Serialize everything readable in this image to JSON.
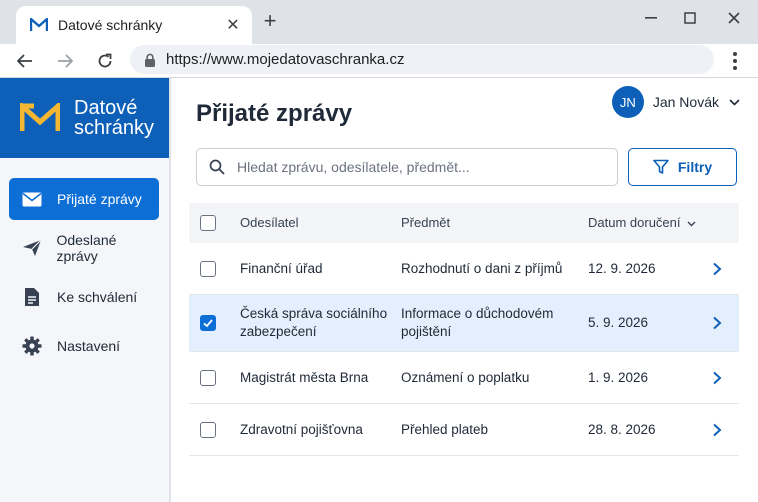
{
  "browser": {
    "tab_title": "Datové schránky",
    "url": "https://www.mojedatovaschranka.cz"
  },
  "app": {
    "brand_line1": "Datové",
    "brand_line2": "schránky"
  },
  "sidebar": {
    "items": [
      {
        "label": "Přijaté zprávy",
        "icon": "envelope-icon",
        "active": true
      },
      {
        "label": "Odeslané zprávy",
        "icon": "paper-plane-icon",
        "active": false
      },
      {
        "label": "Ke schválení",
        "icon": "document-icon",
        "active": false
      },
      {
        "label": "Nastavení",
        "icon": "gear-icon",
        "active": false
      }
    ]
  },
  "header": {
    "page_title": "Přijaté zprávy",
    "user_initials": "JN",
    "user_name": "Jan Novák"
  },
  "search": {
    "placeholder": "Hledat zprávu, odesílatele, předmět...",
    "value": ""
  },
  "filter_label": "Filtry",
  "table": {
    "columns": {
      "sender": "Odesílatel",
      "subject": "Předmět",
      "date": "Datum doručení"
    },
    "rows": [
      {
        "sender": "Finanční úřad",
        "subject": "Rozhodnutí o dani z příjmů",
        "date": "12. 9. 2026",
        "checked": false
      },
      {
        "sender": "Česká správa sociálního zabezpečení",
        "subject": "Informace o důchodovém pojištění",
        "date": "5. 9. 2026",
        "checked": true
      },
      {
        "sender": "Magistrát města Brna",
        "subject": "Oznámení o poplatku",
        "date": "1. 9. 2026",
        "checked": false
      },
      {
        "sender": "Zdravotní pojišťovna",
        "subject": "Přehled plateb",
        "date": "28. 8. 2026",
        "checked": false
      }
    ]
  },
  "colors": {
    "brand": "#0d5fb8",
    "accent": "#0d6fd6",
    "selected_row": "#e3effc",
    "logo_yellow": "#f5b731"
  }
}
